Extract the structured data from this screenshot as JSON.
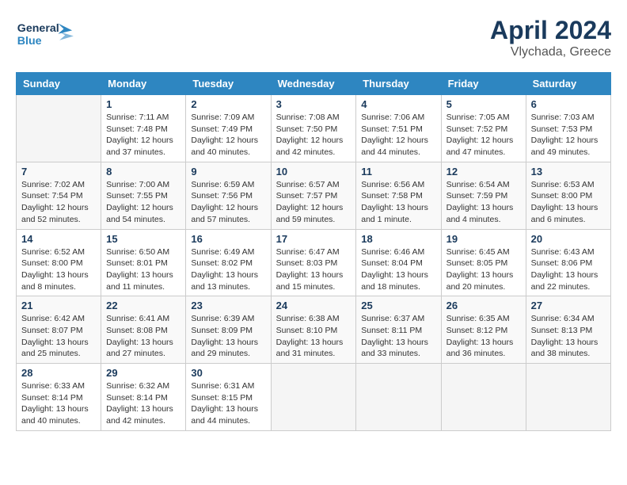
{
  "header": {
    "logo_general": "General",
    "logo_blue": "Blue",
    "title": "April 2024",
    "subtitle": "Vlychada, Greece"
  },
  "days_of_week": [
    "Sunday",
    "Monday",
    "Tuesday",
    "Wednesday",
    "Thursday",
    "Friday",
    "Saturday"
  ],
  "weeks": [
    [
      {
        "day": "",
        "info": ""
      },
      {
        "day": "1",
        "info": "Sunrise: 7:11 AM\nSunset: 7:48 PM\nDaylight: 12 hours\nand 37 minutes."
      },
      {
        "day": "2",
        "info": "Sunrise: 7:09 AM\nSunset: 7:49 PM\nDaylight: 12 hours\nand 40 minutes."
      },
      {
        "day": "3",
        "info": "Sunrise: 7:08 AM\nSunset: 7:50 PM\nDaylight: 12 hours\nand 42 minutes."
      },
      {
        "day": "4",
        "info": "Sunrise: 7:06 AM\nSunset: 7:51 PM\nDaylight: 12 hours\nand 44 minutes."
      },
      {
        "day": "5",
        "info": "Sunrise: 7:05 AM\nSunset: 7:52 PM\nDaylight: 12 hours\nand 47 minutes."
      },
      {
        "day": "6",
        "info": "Sunrise: 7:03 AM\nSunset: 7:53 PM\nDaylight: 12 hours\nand 49 minutes."
      }
    ],
    [
      {
        "day": "7",
        "info": "Sunrise: 7:02 AM\nSunset: 7:54 PM\nDaylight: 12 hours\nand 52 minutes."
      },
      {
        "day": "8",
        "info": "Sunrise: 7:00 AM\nSunset: 7:55 PM\nDaylight: 12 hours\nand 54 minutes."
      },
      {
        "day": "9",
        "info": "Sunrise: 6:59 AM\nSunset: 7:56 PM\nDaylight: 12 hours\nand 57 minutes."
      },
      {
        "day": "10",
        "info": "Sunrise: 6:57 AM\nSunset: 7:57 PM\nDaylight: 12 hours\nand 59 minutes."
      },
      {
        "day": "11",
        "info": "Sunrise: 6:56 AM\nSunset: 7:58 PM\nDaylight: 13 hours\nand 1 minute."
      },
      {
        "day": "12",
        "info": "Sunrise: 6:54 AM\nSunset: 7:59 PM\nDaylight: 13 hours\nand 4 minutes."
      },
      {
        "day": "13",
        "info": "Sunrise: 6:53 AM\nSunset: 8:00 PM\nDaylight: 13 hours\nand 6 minutes."
      }
    ],
    [
      {
        "day": "14",
        "info": "Sunrise: 6:52 AM\nSunset: 8:00 PM\nDaylight: 13 hours\nand 8 minutes."
      },
      {
        "day": "15",
        "info": "Sunrise: 6:50 AM\nSunset: 8:01 PM\nDaylight: 13 hours\nand 11 minutes."
      },
      {
        "day": "16",
        "info": "Sunrise: 6:49 AM\nSunset: 8:02 PM\nDaylight: 13 hours\nand 13 minutes."
      },
      {
        "day": "17",
        "info": "Sunrise: 6:47 AM\nSunset: 8:03 PM\nDaylight: 13 hours\nand 15 minutes."
      },
      {
        "day": "18",
        "info": "Sunrise: 6:46 AM\nSunset: 8:04 PM\nDaylight: 13 hours\nand 18 minutes."
      },
      {
        "day": "19",
        "info": "Sunrise: 6:45 AM\nSunset: 8:05 PM\nDaylight: 13 hours\nand 20 minutes."
      },
      {
        "day": "20",
        "info": "Sunrise: 6:43 AM\nSunset: 8:06 PM\nDaylight: 13 hours\nand 22 minutes."
      }
    ],
    [
      {
        "day": "21",
        "info": "Sunrise: 6:42 AM\nSunset: 8:07 PM\nDaylight: 13 hours\nand 25 minutes."
      },
      {
        "day": "22",
        "info": "Sunrise: 6:41 AM\nSunset: 8:08 PM\nDaylight: 13 hours\nand 27 minutes."
      },
      {
        "day": "23",
        "info": "Sunrise: 6:39 AM\nSunset: 8:09 PM\nDaylight: 13 hours\nand 29 minutes."
      },
      {
        "day": "24",
        "info": "Sunrise: 6:38 AM\nSunset: 8:10 PM\nDaylight: 13 hours\nand 31 minutes."
      },
      {
        "day": "25",
        "info": "Sunrise: 6:37 AM\nSunset: 8:11 PM\nDaylight: 13 hours\nand 33 minutes."
      },
      {
        "day": "26",
        "info": "Sunrise: 6:35 AM\nSunset: 8:12 PM\nDaylight: 13 hours\nand 36 minutes."
      },
      {
        "day": "27",
        "info": "Sunrise: 6:34 AM\nSunset: 8:13 PM\nDaylight: 13 hours\nand 38 minutes."
      }
    ],
    [
      {
        "day": "28",
        "info": "Sunrise: 6:33 AM\nSunset: 8:14 PM\nDaylight: 13 hours\nand 40 minutes."
      },
      {
        "day": "29",
        "info": "Sunrise: 6:32 AM\nSunset: 8:14 PM\nDaylight: 13 hours\nand 42 minutes."
      },
      {
        "day": "30",
        "info": "Sunrise: 6:31 AM\nSunset: 8:15 PM\nDaylight: 13 hours\nand 44 minutes."
      },
      {
        "day": "",
        "info": ""
      },
      {
        "day": "",
        "info": ""
      },
      {
        "day": "",
        "info": ""
      },
      {
        "day": "",
        "info": ""
      }
    ]
  ]
}
